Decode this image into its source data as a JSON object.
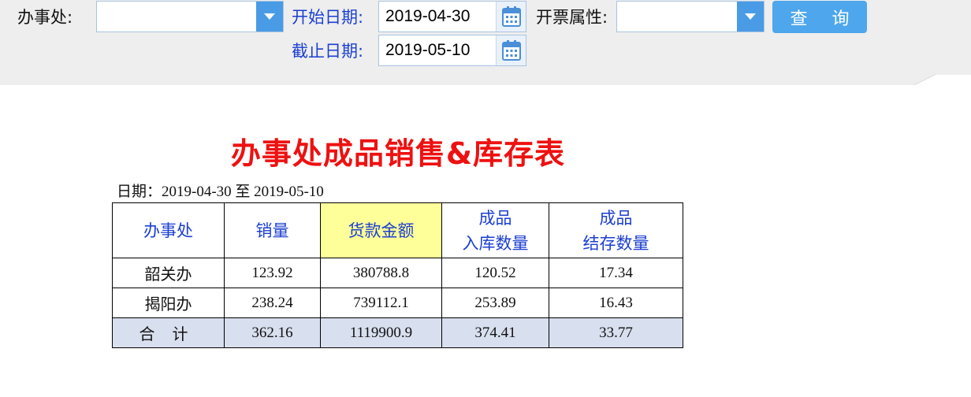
{
  "filters": {
    "office_label": "办事处:",
    "office_value": "",
    "start_date_label": "开始日期:",
    "start_date_value": "2019-04-30",
    "end_date_label": "截止日期:",
    "end_date_value": "2019-05-10",
    "invoice_attr_label": "开票属性:",
    "invoice_attr_value": "",
    "query_button": "查 询"
  },
  "report": {
    "title": "办事处成品销售&库存表",
    "date_range": "日期：2019-04-30 至 2019-05-10",
    "columns": [
      {
        "line1": "办事处",
        "line2": ""
      },
      {
        "line1": "销量",
        "line2": ""
      },
      {
        "line1": "货款金额",
        "line2": ""
      },
      {
        "line1": "成品",
        "line2": "入库数量"
      },
      {
        "line1": "成品",
        "line2": "结存数量"
      }
    ],
    "rows": [
      {
        "office": "韶关办",
        "sales": "123.92",
        "amount": "380788.8",
        "inbound": "120.52",
        "stock": "17.34"
      },
      {
        "office": "揭阳办",
        "sales": "238.24",
        "amount": "739112.1",
        "inbound": "253.89",
        "stock": "16.43"
      }
    ],
    "total": {
      "office": "合计",
      "sales": "362.16",
      "amount": "1119900.9",
      "inbound": "374.41",
      "stock": "33.77"
    }
  },
  "colors": {
    "toolbar_bg": "#eeeeee",
    "label_blue": "#1c3fd0",
    "button_blue": "#4ea6ec",
    "title_red": "#ee1111",
    "highlight_yellow": "#ffff99",
    "total_row_bg": "#d8dfee"
  }
}
